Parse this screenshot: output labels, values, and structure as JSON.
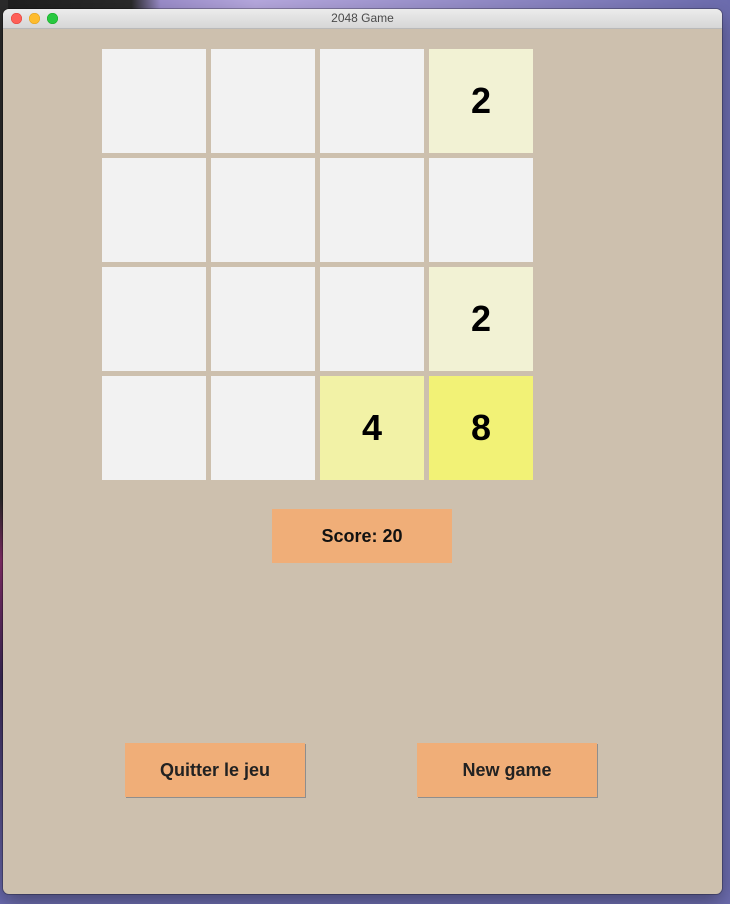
{
  "window": {
    "title": "2048 Game"
  },
  "board": {
    "cells": [
      "",
      "",
      "",
      "2",
      "",
      "",
      "",
      "",
      "",
      "",
      "",
      "2",
      "",
      "",
      "4",
      "8"
    ]
  },
  "tile_colors": {
    "": "#f2f2f2",
    "2": "#f2f2d4",
    "4": "#f2f2a6",
    "8": "#f2f276"
  },
  "score": {
    "text": "Score: 20"
  },
  "buttons": {
    "quit_label": "Quitter le jeu",
    "new_label": "New game"
  },
  "colors": {
    "background": "#cdc0ae",
    "button": "#f0ae78"
  }
}
